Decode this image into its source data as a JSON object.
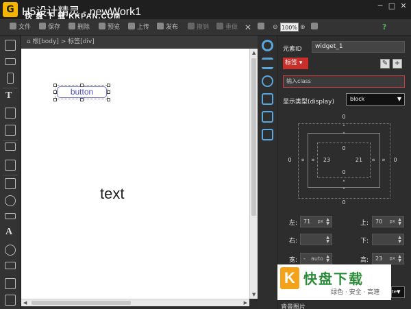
{
  "window": {
    "title": "H5设计精灵 - newWork1",
    "logo_glyph": "G",
    "watermark": "快 盘 下 载 KKPAN.COM",
    "controls": [
      "─",
      "□",
      "✕"
    ]
  },
  "toolbar": {
    "file": "文件",
    "save": "保存",
    "delete": "删除",
    "preview": "预览",
    "upload": "上传",
    "publish": "发布",
    "undo": "撤销",
    "redo": "重做",
    "zoom": "100%",
    "help": "?"
  },
  "breadcrumb": "根[body]  >  标签[div]",
  "canvas": {
    "button_label": "button",
    "text_label": "text"
  },
  "props": {
    "element_id_label": "元素ID",
    "element_id_value": "widget_1",
    "tag_label": "标签",
    "class_placeholder": "输入class",
    "display_label": "显示类型(display)",
    "display_value": "block",
    "box": {
      "margin_top": "0",
      "margin_bottom": "0",
      "margin_left": "0",
      "margin_right": "0",
      "padding_top": "0",
      "padding_bottom": "0",
      "padding_left": "23",
      "padding_right": "21"
    },
    "left_label": "左:",
    "left_value": "71",
    "left_unit": "px",
    "top_label": "上:",
    "top_value": "70",
    "top_unit": "px",
    "right_label": "右:",
    "bottom_label": "下:",
    "width_label": "宽:",
    "width_value": "auto",
    "width_prefix": "-",
    "height_label": "高:",
    "height_value": "23",
    "height_unit": "px",
    "partial_value": "te",
    "bg_image_label": "背景图片"
  },
  "watermark_badge": {
    "glyph": "K",
    "title": "快盘下载",
    "subtitle": "绿色 · 安全 · 高速"
  }
}
